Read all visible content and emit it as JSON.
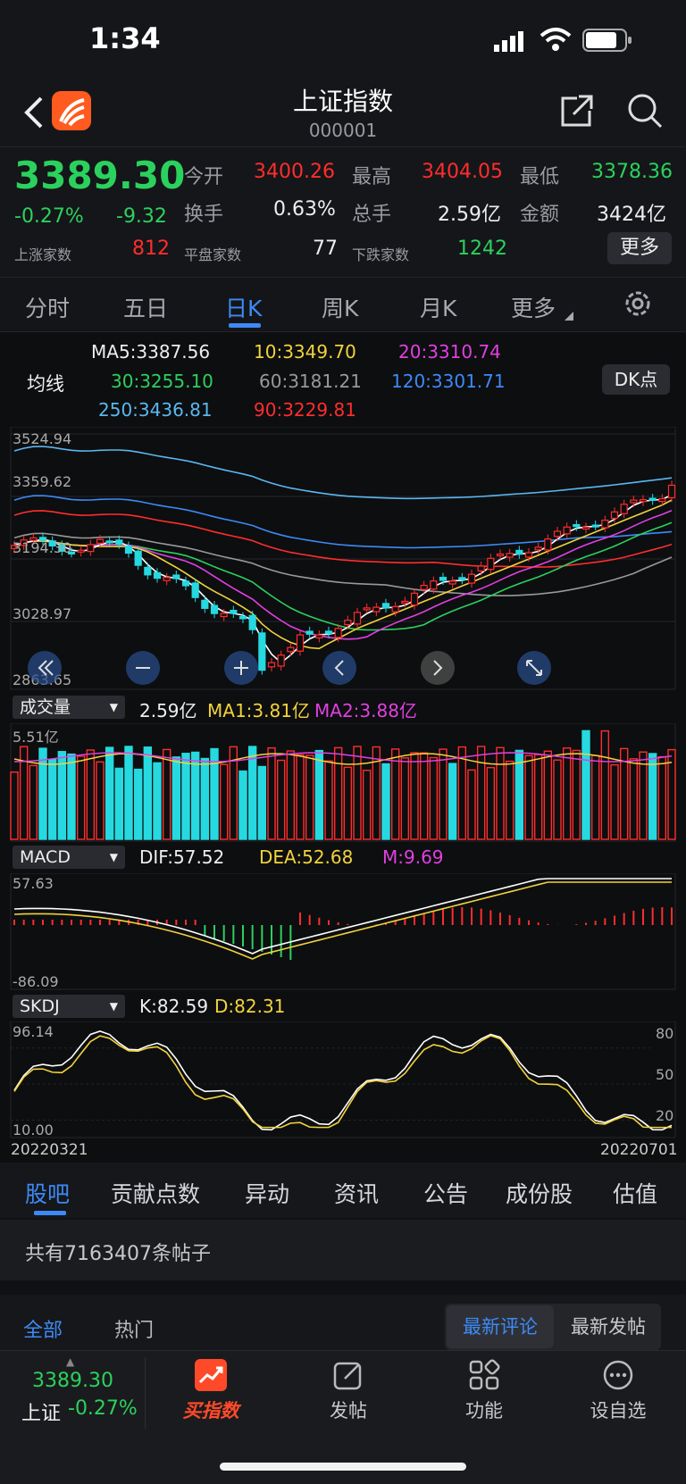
{
  "status": {
    "time": "1:34"
  },
  "header": {
    "title": "上证指数",
    "code": "000001"
  },
  "quote": {
    "price": "3389.30",
    "change_pct": "-0.27%",
    "change": "-9.32",
    "open_label": "今开",
    "open": "3400.26",
    "high_label": "最高",
    "high": "3404.05",
    "low_label": "最低",
    "low": "3378.36",
    "turnover_label": "换手",
    "turnover": "0.63%",
    "volume_label": "总手",
    "volume": "2.59亿",
    "amount_label": "金额",
    "amount": "3424亿",
    "up_label": "上涨家数",
    "up": "812",
    "flat_label": "平盘家数",
    "flat": "77",
    "down_label": "下跌家数",
    "down": "1242",
    "more": "更多"
  },
  "tabs": {
    "t1": "分时",
    "t2": "五日",
    "t3": "日K",
    "t4": "周K",
    "t5": "月K",
    "t6": "更多"
  },
  "ma": {
    "label": "均线",
    "ma5": "MA5:3387.56",
    "ma10": "10:3349.70",
    "ma20": "20:3310.74",
    "ma30": "30:3255.10",
    "ma60": "60:3181.21",
    "ma120": "120:3301.71",
    "ma250": "250:3436.81",
    "ma90": "90:3229.81",
    "dk": "DK点"
  },
  "price_axis": {
    "p1": "3524.94",
    "p2": "3359.62",
    "p3": "3194.30",
    "p4": "3028.97",
    "p5": "2863.65"
  },
  "volume": {
    "selector": "成交量",
    "value": "2.59亿",
    "ma1": "MA1:3.81亿",
    "ma2": "MA2:3.88亿",
    "max": "5.51亿"
  },
  "macd": {
    "selector": "MACD",
    "dif": "DIF:57.52",
    "dea": "DEA:52.68",
    "m": "M:9.69",
    "max": "57.63",
    "min": "-86.09"
  },
  "skdj": {
    "selector": "SKDJ",
    "k": "K:82.59",
    "d": "D:82.31",
    "max": "96.14",
    "min": "10.00",
    "l80": "80",
    "l50": "50",
    "l20": "20"
  },
  "dates": {
    "start": "20220321",
    "end": "20220701"
  },
  "bottom_tabs": {
    "b1": "股吧",
    "b2": "贡献点数",
    "b3": "异动",
    "b4": "资讯",
    "b5": "公告",
    "b6": "成份股",
    "b7": "估值"
  },
  "posts": {
    "count_text": "共有7163407条帖子"
  },
  "filters": {
    "all": "全部",
    "hot": "热门",
    "latest_comment": "最新评论",
    "latest_post": "最新发帖"
  },
  "toolbar": {
    "price": "3389.30",
    "name": "上证",
    "pct": "-0.27%",
    "buy": "买指数",
    "post": "发帖",
    "func": "功能",
    "watch": "设自选"
  },
  "colors": {
    "up": "#ff2d2d",
    "down": "#2bd15d",
    "accent": "#3d8af7",
    "volume_down": "#26d9e0"
  },
  "chart_data": [
    {
      "type": "candlestick",
      "title": "",
      "x_range": [
        "20220321",
        "20220701"
      ],
      "ylim": [
        2863.65,
        3524.94
      ],
      "yticks": [
        3524.94,
        3359.62,
        3194.3,
        3028.97,
        2863.65
      ],
      "last_close": 3389.3,
      "series": [
        {
          "name": "MA5",
          "last": 3387.56
        },
        {
          "name": "MA10",
          "last": 3349.7
        },
        {
          "name": "MA20",
          "last": 3310.74
        },
        {
          "name": "MA30",
          "last": 3255.1
        },
        {
          "name": "MA60",
          "last": 3181.21
        },
        {
          "name": "MA120",
          "last": 3301.71
        },
        {
          "name": "MA250",
          "last": 3436.81
        },
        {
          "name": "MA90",
          "last": 3229.81
        }
      ]
    },
    {
      "type": "bar",
      "title": "成交量",
      "ylim": [
        0,
        5.51
      ],
      "last": 2.59,
      "series": [
        {
          "name": "MA1",
          "last": 3.81
        },
        {
          "name": "MA2",
          "last": 3.88
        }
      ]
    },
    {
      "type": "bar",
      "title": "MACD",
      "ylim": [
        -86.09,
        57.63
      ],
      "series": [
        {
          "name": "DIF",
          "last": 57.52
        },
        {
          "name": "DEA",
          "last": 52.68
        },
        {
          "name": "M",
          "last": 9.69
        }
      ]
    },
    {
      "type": "line",
      "title": "SKDJ",
      "ylim": [
        10.0,
        96.14
      ],
      "series": [
        {
          "name": "K",
          "last": 82.59
        },
        {
          "name": "D",
          "last": 82.31
        }
      ]
    }
  ]
}
